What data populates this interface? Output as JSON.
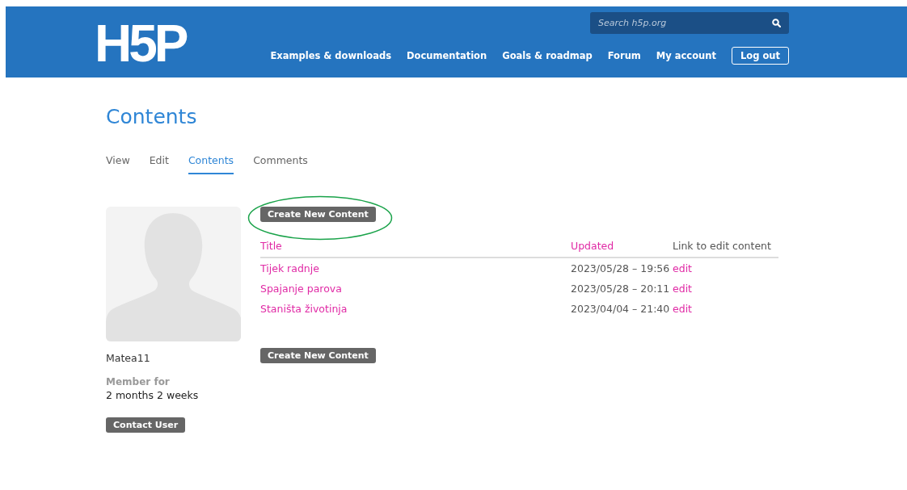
{
  "header": {
    "logo": "H5P",
    "search": {
      "placeholder": "Search h5p.org"
    },
    "nav": [
      {
        "label": "Examples & downloads",
        "kind": "link"
      },
      {
        "label": "Documentation",
        "kind": "link"
      },
      {
        "label": "Goals & roadmap",
        "kind": "link"
      },
      {
        "label": "Forum",
        "kind": "link"
      },
      {
        "label": "My account",
        "kind": "link"
      },
      {
        "label": "Log out",
        "kind": "button"
      }
    ]
  },
  "page_title": "Contents",
  "tabs": [
    {
      "label": "View",
      "selected": false
    },
    {
      "label": "Edit",
      "selected": false
    },
    {
      "label": "Contents",
      "selected": true
    },
    {
      "label": "Comments",
      "selected": false
    }
  ],
  "profile": {
    "username": "Matea11",
    "member_label": "Member for",
    "member_value": "2 months 2 weeks",
    "contact_button": "Contact User"
  },
  "create_button_top": {
    "label": "Create New Content",
    "highlighted": true
  },
  "table": {
    "columns": [
      "Title",
      "Updated",
      "Link to edit content"
    ],
    "rows": [
      {
        "title": "Tijek radnje",
        "updated": "2023/05/28 – 19:56",
        "link": "edit"
      },
      {
        "title": "Spajanje parova",
        "updated": "2023/05/28 – 20:11",
        "link": "edit"
      },
      {
        "title": "Staništa životinja",
        "updated": "2023/04/04 – 21:40",
        "link": "edit"
      }
    ]
  },
  "create_button_bottom": "Create New Content"
}
